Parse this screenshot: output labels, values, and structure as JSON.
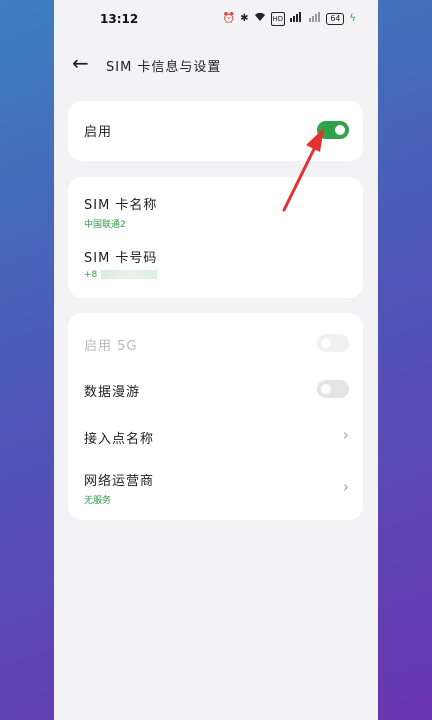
{
  "status": {
    "time": "13:12",
    "battery": "64"
  },
  "nav": {
    "title": "SIM 卡信息与设置"
  },
  "enable_card": {
    "label": "启用"
  },
  "sim_info": {
    "name_label": "SIM 卡名称",
    "name_value": "中国联通2",
    "number_label": "SIM 卡号码",
    "number_value": "+8"
  },
  "settings": {
    "enable_5g_label": "启用 5G",
    "roaming_label": "数据漫游",
    "apn_label": "接入点名称",
    "operator_label": "网络运营商",
    "operator_value": "无服务"
  },
  "colors": {
    "accent_green": "#2fa24a",
    "arrow_red": "#e53030"
  }
}
